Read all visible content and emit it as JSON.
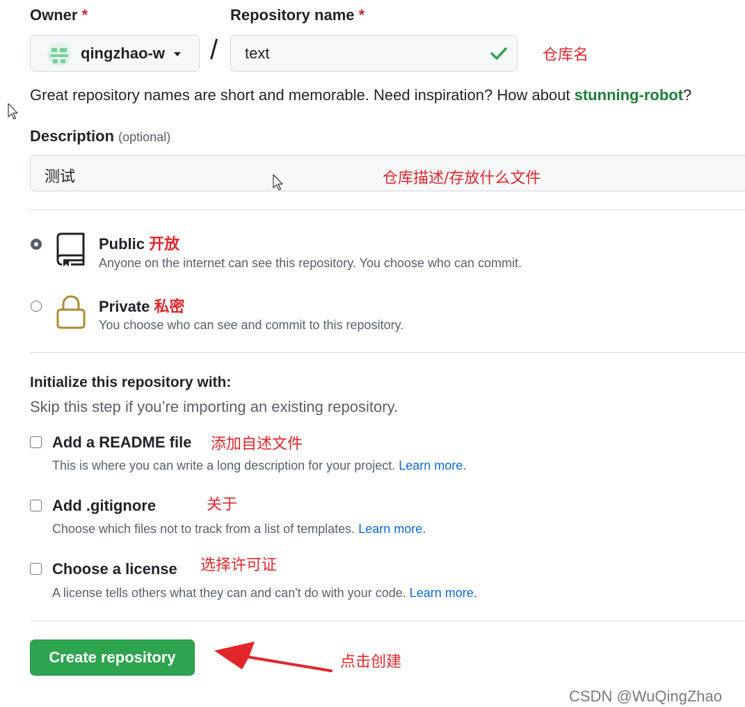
{
  "owner": {
    "label": "Owner",
    "required_mark": "*",
    "value": "qingzhao-w"
  },
  "repository_name": {
    "label": "Repository name",
    "required_mark": "*",
    "value": "text",
    "annotation": "仓库名",
    "valid_icon": "check-icon"
  },
  "separator": "/",
  "hint": {
    "text": "Great repository names are short and memorable. Need inspiration? How about ",
    "suggestion": "stunning-robot",
    "suffix": "?"
  },
  "description": {
    "label": "Description",
    "optional": "(optional)",
    "value": "测试",
    "annotation": "仓库描述/存放什么文件"
  },
  "visibility": {
    "public": {
      "title": "Public",
      "annotation": "开放",
      "subtitle": "Anyone on the internet can see this repository. You choose who can commit.",
      "selected": true,
      "icon": "repo-icon"
    },
    "private": {
      "title": "Private",
      "annotation": "私密",
      "subtitle": "You choose who can see and commit to this repository.",
      "selected": false,
      "icon": "lock-icon"
    }
  },
  "initialize": {
    "title": "Initialize this repository with:",
    "subtitle": "Skip this step if you’re importing an existing repository.",
    "options": [
      {
        "title": "Add a README file",
        "annotation": "添加自述文件",
        "subtitle": "This is where you can write a long description for your project. ",
        "link": "Learn more.",
        "checked": false
      },
      {
        "title": "Add .gitignore",
        "annotation": "关于",
        "subtitle": "Choose which files not to track from a list of templates. ",
        "link": "Learn more.",
        "checked": false
      },
      {
        "title": "Choose a license",
        "annotation": "选择许可证",
        "subtitle": "A license tells others what they can and can't do with your code. ",
        "link": "Learn more.",
        "checked": false
      }
    ]
  },
  "create_button": {
    "label": "Create repository",
    "annotation": "点击创建"
  },
  "watermark": "CSDN @WuQingZhao",
  "colors": {
    "accent_green": "#2da44e",
    "link_blue": "#0969da",
    "annotation_red": "#e3262b",
    "suggestion_green": "#1a7f37"
  }
}
